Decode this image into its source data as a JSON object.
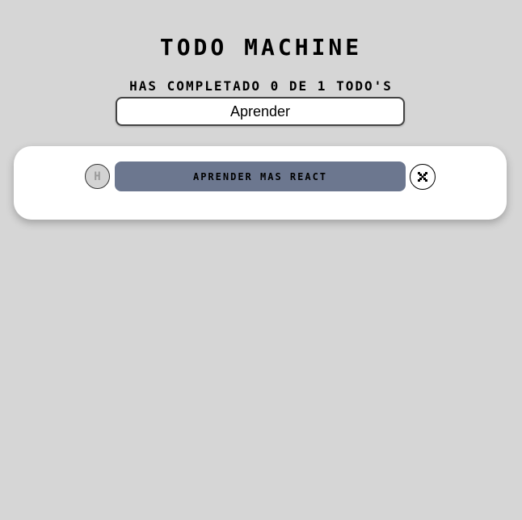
{
  "app": {
    "title": "Todo Machine"
  },
  "counter": {
    "text": "Has completado 0 de 1 TODO's"
  },
  "search": {
    "value": "Aprender"
  },
  "todos": [
    {
      "text": "aprender mas react",
      "completed": false,
      "check_glyph": "H",
      "check_icon": "check-icon",
      "delete_icon": "close-icon"
    }
  ],
  "colors": {
    "background": "#d6d6d6",
    "todo_item_bg": "#6c778f",
    "panel_bg": "#ffffff",
    "check_bg": "#d3d3d3"
  }
}
